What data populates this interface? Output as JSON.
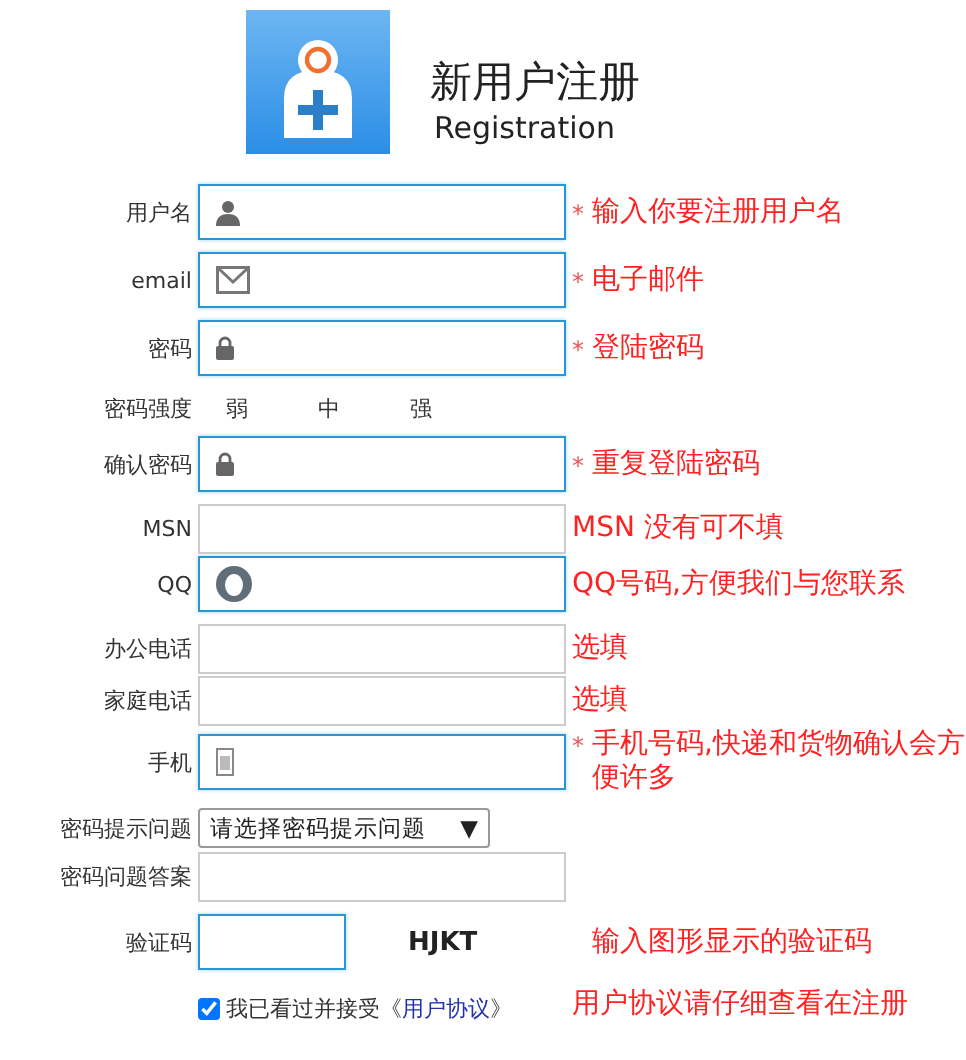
{
  "header": {
    "title": "新用户注册",
    "subtitle": "Registration"
  },
  "rows": [
    {
      "kind": "user",
      "label": "用户名",
      "highlighted": true,
      "asterisk": "*",
      "hint": "输入你要注册用户名"
    },
    {
      "kind": "email",
      "label": "email",
      "highlighted": true,
      "asterisk": "*",
      "hint": "电子邮件"
    },
    {
      "kind": "password",
      "label": "密码",
      "highlighted": true,
      "asterisk": "*",
      "hint": "登陆密码"
    },
    {
      "kind": "strength",
      "label": "密码强度",
      "levels": [
        "弱",
        "中",
        "强"
      ]
    },
    {
      "kind": "password",
      "label": "确认密码",
      "highlighted": true,
      "asterisk": "*",
      "hint": "重复登陆密码"
    },
    {
      "kind": "plain",
      "label": "MSN",
      "highlighted": false,
      "hint": "MSN 没有可不填"
    },
    {
      "kind": "qq",
      "label": "QQ",
      "highlighted": true,
      "hint": "QQ号码,方便我们与您联系"
    },
    {
      "kind": "plain",
      "label": "办公电话",
      "highlighted": false,
      "hint": "选填"
    },
    {
      "kind": "plain",
      "label": "家庭电话",
      "highlighted": false,
      "hint": "选填"
    },
    {
      "kind": "mobile",
      "label": "手机",
      "highlighted": true,
      "asterisk": "*",
      "hint": "手机号码,快递和货物确认会方便许多"
    },
    {
      "kind": "select",
      "label": "密码提示问题",
      "value": "请选择密码提示问题",
      "arrow": "▼"
    },
    {
      "kind": "plain",
      "label": "密码问题答案",
      "highlighted": false
    },
    {
      "kind": "captcha",
      "label": "验证码",
      "highlighted": true,
      "code": "HJKT",
      "hint": "输入图形显示的验证码"
    }
  ],
  "agreement": {
    "checked": true,
    "text": "我已看过并接受《",
    "link": "用户协议",
    "text_after": "》",
    "hint": "用户协议请仔细查看在注册"
  }
}
